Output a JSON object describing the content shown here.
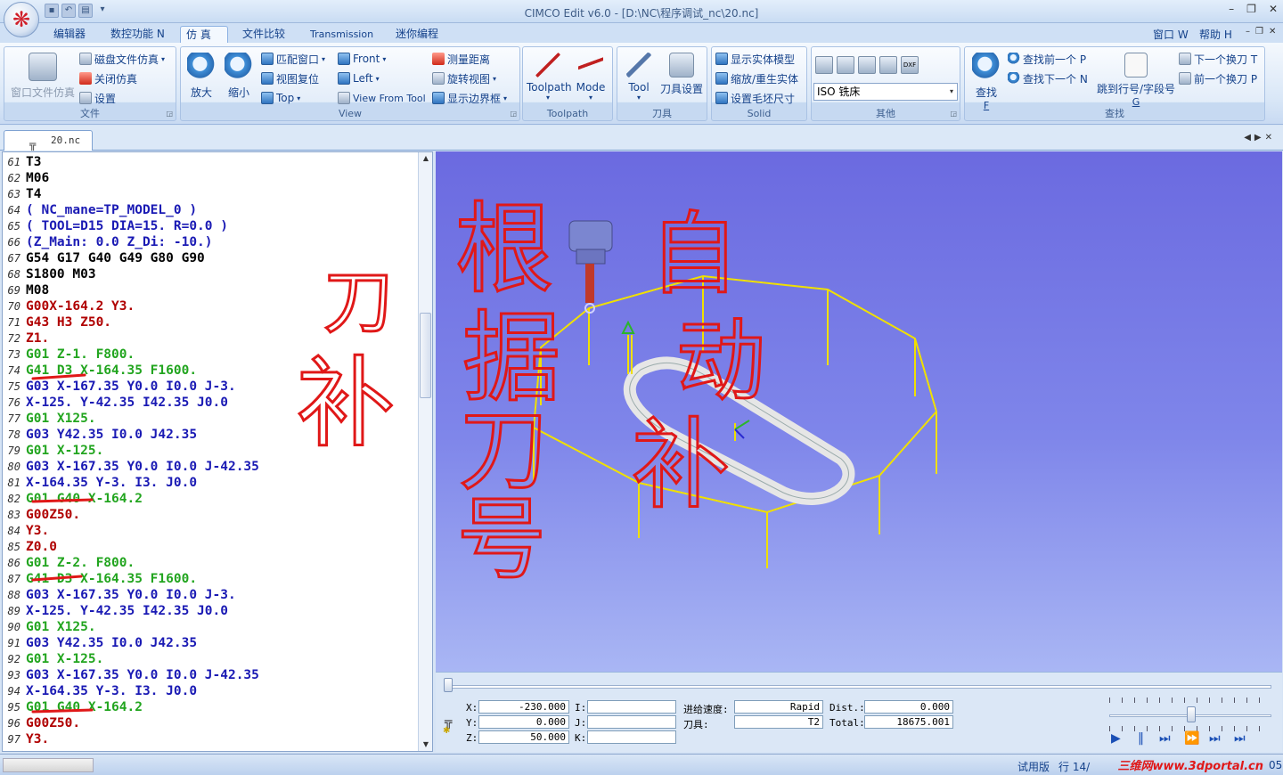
{
  "window": {
    "title": "CIMCO Edit v6.0 - [D:\\NC\\程序调试_nc\\20.nc]",
    "menu_right": [
      "窗口 W",
      "帮助 H"
    ]
  },
  "ribbon_tabs": [
    "编辑器",
    "数控功能 N",
    "仿 真",
    "文件比较",
    "Transmission",
    "迷你编程"
  ],
  "ribbon": {
    "file_group": {
      "caption": "文件",
      "big_button": "窗口文件仿真",
      "items": [
        "磁盘文件仿真",
        "关闭仿真",
        "设置"
      ]
    },
    "view_group": {
      "caption": "View",
      "zoom_in": "放大",
      "zoom_out": "缩小",
      "items": [
        "匹配窗口",
        "视图复位",
        "Top",
        "Front",
        "Left",
        "View From Tool",
        "测量距离",
        "旋转视图",
        "显示边界框"
      ]
    },
    "toolpath_group": {
      "caption": "Toolpath",
      "buttons": [
        "Toolpath",
        "Mode"
      ]
    },
    "tool_group": {
      "caption": "刀具",
      "buttons": [
        "Tool",
        "刀具设置"
      ]
    },
    "solid_group": {
      "caption": "Solid",
      "items": [
        "显示实体模型",
        "缩放/重生实体",
        "设置毛坯尺寸"
      ]
    },
    "other_group": {
      "caption": "其他",
      "machine_select": "ISO 铣床",
      "icon_tags": [
        "",
        "",
        "",
        "",
        "DXF"
      ]
    },
    "find_group": {
      "caption": "查找",
      "find": "查找",
      "find_key": "F",
      "items": [
        "查找前一个 P",
        "查找下一个 N"
      ],
      "jump": "跳到行号/字段号",
      "jump_key": "G",
      "tool_prev_next": [
        "下一个换刀 T",
        "前一个换刀 P"
      ]
    }
  },
  "document_tab": "20.nc",
  "code_lines": [
    {
      "n": "61",
      "t": "T3",
      "c": "black"
    },
    {
      "n": "62",
      "t": "M06",
      "c": "black"
    },
    {
      "n": "63",
      "t": "T4",
      "c": "black"
    },
    {
      "n": "64",
      "t": "( NC_mane=TP_MODEL_0 )",
      "c": "blue"
    },
    {
      "n": "65",
      "t": "( TOOL=D15 DIA=15. R=0.0 )",
      "c": "blue"
    },
    {
      "n": "66",
      "t": "(Z_Main: 0.0 Z_Di: -10.)",
      "c": "blue"
    },
    {
      "n": "67",
      "t": "G54 G17 G40 G49 G80 G90",
      "c": "black"
    },
    {
      "n": "68",
      "t": "S1800 M03",
      "c": "black"
    },
    {
      "n": "69",
      "t": "M08",
      "c": "black"
    },
    {
      "n": "70",
      "t": "G00X-164.2 Y3.",
      "c": "red"
    },
    {
      "n": "71",
      "t": "G43 H3 Z50.",
      "c": "red"
    },
    {
      "n": "72",
      "t": "Z1.",
      "c": "red"
    },
    {
      "n": "73",
      "t": "G01 Z-1. F800.",
      "c": "green"
    },
    {
      "n": "74",
      "t": "G41 D3 X-164.35 F1600.",
      "c": "green"
    },
    {
      "n": "75",
      "t": "G03 X-167.35 Y0.0 I0.0 J-3.",
      "c": "blue"
    },
    {
      "n": "76",
      "t": "X-125. Y-42.35 I42.35 J0.0",
      "c": "blue"
    },
    {
      "n": "77",
      "t": "G01 X125.",
      "c": "green"
    },
    {
      "n": "78",
      "t": "G03 Y42.35 I0.0 J42.35",
      "c": "blue"
    },
    {
      "n": "79",
      "t": "G01 X-125.",
      "c": "green"
    },
    {
      "n": "80",
      "t": "G03 X-167.35 Y0.0 I0.0 J-42.35",
      "c": "blue"
    },
    {
      "n": "81",
      "t": "X-164.35 Y-3. I3. J0.0",
      "c": "blue"
    },
    {
      "n": "82",
      "t": "G01 G40 X-164.2",
      "c": "green"
    },
    {
      "n": "83",
      "t": "G00Z50.",
      "c": "red"
    },
    {
      "n": "84",
      "t": "Y3.",
      "c": "red"
    },
    {
      "n": "85",
      "t": "Z0.0",
      "c": "red"
    },
    {
      "n": "86",
      "t": "G01 Z-2. F800.",
      "c": "green"
    },
    {
      "n": "87",
      "t": "G41 D3 X-164.35 F1600.",
      "c": "green"
    },
    {
      "n": "88",
      "t": "G03 X-167.35 Y0.0 I0.0 J-3.",
      "c": "blue"
    },
    {
      "n": "89",
      "t": "X-125. Y-42.35 I42.35 J0.0",
      "c": "blue"
    },
    {
      "n": "90",
      "t": "G01 X125.",
      "c": "green"
    },
    {
      "n": "91",
      "t": "G03 Y42.35 I0.0 J42.35",
      "c": "blue"
    },
    {
      "n": "92",
      "t": "G01 X-125.",
      "c": "green"
    },
    {
      "n": "93",
      "t": "G03 X-167.35 Y0.0 I0.0 J-42.35",
      "c": "blue"
    },
    {
      "n": "94",
      "t": "X-164.35 Y-3. I3. J0.0",
      "c": "blue"
    },
    {
      "n": "95",
      "t": "G01 G40 X-164.2",
      "c": "green"
    },
    {
      "n": "96",
      "t": "G00Z50.",
      "c": "red"
    },
    {
      "n": "97",
      "t": "Y3.",
      "c": "red"
    }
  ],
  "annotations": {
    "left_text": [
      "刀",
      "补"
    ],
    "viewport_text": [
      "根",
      "据",
      "刀",
      "号",
      "自",
      "动",
      "补"
    ]
  },
  "sim_panel": {
    "x_label": "X:",
    "x_value": "-230.000",
    "y_label": "Y:",
    "y_value": "0.000",
    "z_label": "Z:",
    "z_value": "50.000",
    "i_label": "I:",
    "j_label": "J:",
    "k_label": "K:",
    "feed_label": "进给速度:",
    "feed_value": "Rapid",
    "tool_label": "刀具:",
    "tool_value": "T2",
    "dist_label": "Dist.:",
    "dist_value": "0.000",
    "total_label": "Total:",
    "total_value": "18675.001"
  },
  "status": {
    "mode": "试用版",
    "line": "行 14/",
    "tail": "05",
    "watermark": "三维网www.3dportal.cn"
  },
  "colors": {
    "code_red": "#b00000",
    "code_green": "#22a51f",
    "code_blue": "#1a1ab4",
    "wire": "#f0e000",
    "ink": "#e01818"
  }
}
